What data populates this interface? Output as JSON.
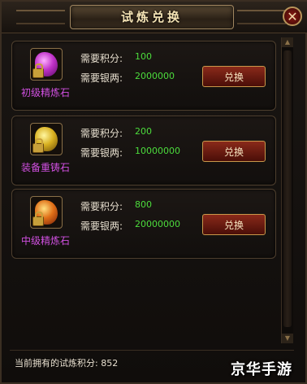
{
  "window": {
    "title": "试炼兑换",
    "close_label": "✕"
  },
  "items": [
    {
      "name": "初级精炼石",
      "icon": "purple-refine-stone-icon",
      "points_label": "需要积分:",
      "points": "100",
      "silver_label": "需要银两:",
      "silver": "2000000",
      "button_label": "兑换"
    },
    {
      "name": "装备重铸石",
      "icon": "gold-recast-stone-icon",
      "points_label": "需要积分:",
      "points": "200",
      "silver_label": "需要银两:",
      "silver": "10000000",
      "button_label": "兑换"
    },
    {
      "name": "中级精炼石",
      "icon": "orange-refine-stone-icon",
      "points_label": "需要积分:",
      "points": "800",
      "silver_label": "需要银两:",
      "silver": "20000000",
      "button_label": "兑换"
    }
  ],
  "footer": {
    "current_points_text": "当前拥有的试炼积分: 852"
  },
  "watermark": "京华手游",
  "colors": {
    "accent_green": "#4cdc3c",
    "item_name_purple": "#d050e0",
    "button_red": "#8a2a1a",
    "border_gold": "#c8984a"
  }
}
